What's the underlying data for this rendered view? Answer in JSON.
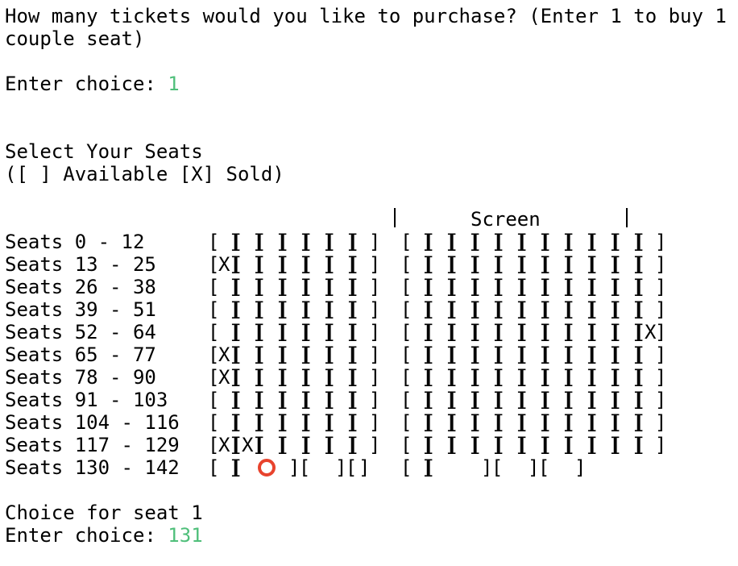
{
  "prompt": {
    "line1": "How many tickets would you like to purchase? (Enter 1 to buy 1",
    "line2": "couple seat)",
    "enter_label": "Enter choice: ",
    "enter_value": "1"
  },
  "select": {
    "title": "Select Your Seats",
    "legend": "([ ] Available [X] Sold)"
  },
  "screen_label": "Screen",
  "rows": [
    {
      "label": "Seats 0 - 12",
      "left": [
        "[ ]",
        "[ ]",
        "[ ]",
        "[ ]",
        "[ ]",
        "[ ]",
        "[ ]"
      ],
      "right": [
        "[ ]",
        "[ ]",
        "[ ]",
        "[ ]",
        "[ ]",
        "[ ]",
        "[ ]",
        "[ ]",
        "[ ]",
        "[ ]",
        "[ ]"
      ]
    },
    {
      "label": "Seats 13 - 25",
      "left": [
        "[X]",
        "[ ]",
        "[ ]",
        "[ ]",
        "[ ]",
        "[ ]",
        "[ ]"
      ],
      "right": [
        "[ ]",
        "[ ]",
        "[ ]",
        "[ ]",
        "[ ]",
        "[ ]",
        "[ ]",
        "[ ]",
        "[ ]",
        "[ ]",
        "[ ]"
      ]
    },
    {
      "label": "Seats 26 - 38",
      "left": [
        "[ ]",
        "[ ]",
        "[ ]",
        "[ ]",
        "[ ]",
        "[ ]",
        "[ ]"
      ],
      "right": [
        "[ ]",
        "[ ]",
        "[ ]",
        "[ ]",
        "[ ]",
        "[ ]",
        "[ ]",
        "[ ]",
        "[ ]",
        "[ ]",
        "[ ]"
      ]
    },
    {
      "label": "Seats 39 - 51",
      "left": [
        "[ ]",
        "[ ]",
        "[ ]",
        "[ ]",
        "[ ]",
        "[ ]",
        "[ ]"
      ],
      "right": [
        "[ ]",
        "[ ]",
        "[ ]",
        "[ ]",
        "[ ]",
        "[ ]",
        "[ ]",
        "[ ]",
        "[ ]",
        "[ ]",
        "[ ]"
      ]
    },
    {
      "label": "Seats 52 - 64",
      "left": [
        "[ ]",
        "[ ]",
        "[ ]",
        "[ ]",
        "[ ]",
        "[ ]",
        "[ ]"
      ],
      "right": [
        "[ ]",
        "[ ]",
        "[ ]",
        "[ ]",
        "[ ]",
        "[ ]",
        "[ ]",
        "[ ]",
        "[ ]",
        "[ ]",
        "[X]"
      ]
    },
    {
      "label": "Seats 65 - 77",
      "left": [
        "[X]",
        "[ ]",
        "[ ]",
        "[ ]",
        "[ ]",
        "[ ]",
        "[ ]"
      ],
      "right": [
        "[ ]",
        "[ ]",
        "[ ]",
        "[ ]",
        "[ ]",
        "[ ]",
        "[ ]",
        "[ ]",
        "[ ]",
        "[ ]",
        "[ ]"
      ]
    },
    {
      "label": "Seats 78 - 90",
      "left": [
        "[X]",
        "[ ]",
        "[ ]",
        "[ ]",
        "[ ]",
        "[ ]",
        "[ ]"
      ],
      "right": [
        "[ ]",
        "[ ]",
        "[ ]",
        "[ ]",
        "[ ]",
        "[ ]",
        "[ ]",
        "[ ]",
        "[ ]",
        "[ ]",
        "[ ]"
      ]
    },
    {
      "label": "Seats 91 - 103",
      "left": [
        "[ ]",
        "[ ]",
        "[ ]",
        "[ ]",
        "[ ]",
        "[ ]",
        "[ ]"
      ],
      "right": [
        "[ ]",
        "[ ]",
        "[ ]",
        "[ ]",
        "[ ]",
        "[ ]",
        "[ ]",
        "[ ]",
        "[ ]",
        "[ ]",
        "[ ]"
      ]
    },
    {
      "label": "Seats 104 - 116",
      "left": [
        "[ ]",
        "[ ]",
        "[ ]",
        "[ ]",
        "[ ]",
        "[ ]",
        "[ ]"
      ],
      "right": [
        "[ ]",
        "[ ]",
        "[ ]",
        "[ ]",
        "[ ]",
        "[ ]",
        "[ ]",
        "[ ]",
        "[ ]",
        "[ ]",
        "[ ]"
      ]
    },
    {
      "label": "Seats 117 - 129",
      "left": [
        "[X]",
        "[X]",
        "[ ]",
        "[ ]",
        "[ ]",
        "[ ]",
        "[ ]"
      ],
      "right": [
        "[ ]",
        "[ ]",
        "[ ]",
        "[ ]",
        "[ ]",
        "[ ]",
        "[ ]",
        "[ ]",
        "[ ]",
        "[ ]",
        "[ ]"
      ]
    }
  ],
  "couple_row": {
    "label": "Seats 130 - 142",
    "left": [
      "[ ]",
      "[",
      "",
      " ][",
      "",
      " ][",
      " ]"
    ],
    "right": [
      "[ ]",
      "[",
      "",
      " ][",
      "",
      " ][",
      "",
      " ]"
    ]
  },
  "footer": {
    "choice_label": "Choice for seat 1",
    "enter_label": "Enter choice: ",
    "enter_value": "131"
  }
}
